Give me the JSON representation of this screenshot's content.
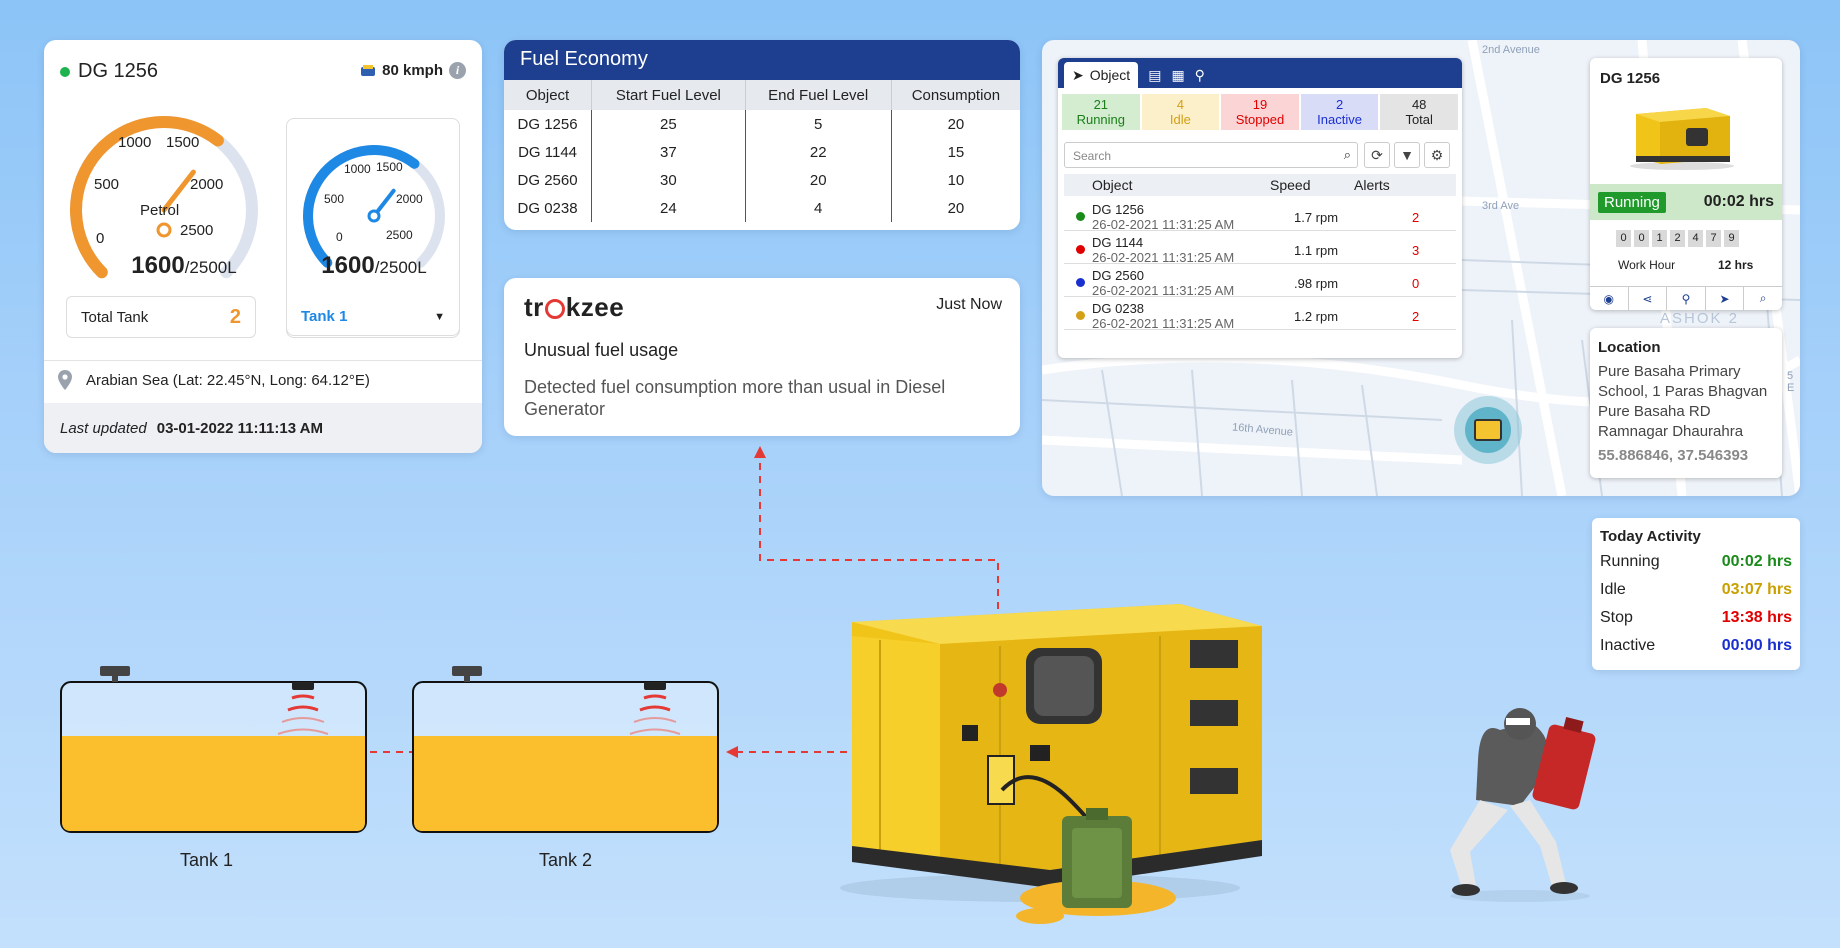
{
  "gauge_card": {
    "device": "DG 1256",
    "status_color": "#1fb34f",
    "speed": "80 kmph",
    "info_icon": "info-icon",
    "big_gauge": {
      "labels": [
        "0",
        "500",
        "1000",
        "1500",
        "2000",
        "2500"
      ],
      "center_label": "Petrol",
      "value": "1600",
      "capacity": "/2500L",
      "fill_fraction": 0.64,
      "color": "#f0962e"
    },
    "small_gauge": {
      "labels": [
        "0",
        "500",
        "1000",
        "1500",
        "2000",
        "2500"
      ],
      "value": "1600",
      "capacity": "/2500L",
      "fill_fraction": 0.64,
      "color": "#1e88e5"
    },
    "total_tank_label": "Total Tank",
    "total_tank_value": "2",
    "tank_select": "Tank 1",
    "location": "Arabian Sea (Lat: 22.45°N, Long: 64.12°E)",
    "last_updated_label": "Last updated",
    "last_updated_value": "03-01-2022 11:11:13 AM"
  },
  "fuel_economy": {
    "title": "Fuel Economy",
    "columns": [
      "Object",
      "Start Fuel Level",
      "End Fuel Level",
      "Consumption"
    ],
    "rows": [
      [
        "DG 1256",
        "25",
        "5",
        "20"
      ],
      [
        "DG 1144",
        "37",
        "22",
        "15"
      ],
      [
        "DG 2560",
        "30",
        "20",
        "10"
      ],
      [
        "DG 0238",
        "24",
        "4",
        "20"
      ]
    ]
  },
  "notification": {
    "brand_a": "tr",
    "brand_b": "kzee",
    "time": "Just Now",
    "title": "Unusual fuel usage",
    "body": "Detected fuel consumption more than usual in Diesel Generator"
  },
  "object_panel": {
    "tab_label": "Object",
    "tab_icons": [
      "clipboard-icon",
      "grid-icon",
      "person-pin-icon"
    ],
    "status": [
      {
        "count": "21",
        "label": "Running",
        "color": "#1a7f1a",
        "bg": "#d4ecd0"
      },
      {
        "count": "4",
        "label": "Idle",
        "color": "#d4a017",
        "bg": "#fbf0c9"
      },
      {
        "count": "19",
        "label": "Stopped",
        "color": "#e00000",
        "bg": "#fbd5d5"
      },
      {
        "count": "2",
        "label": "Inactive",
        "color": "#1a2fd0",
        "bg": "#d9dcf7"
      },
      {
        "count": "48",
        "label": "Total",
        "color": "#222222",
        "bg": "#e4e4e4"
      }
    ],
    "search_placeholder": "Search",
    "columns": [
      "Object",
      "Speed",
      "Alerts"
    ],
    "rows": [
      {
        "name": "DG 1256",
        "time": "26-02-2021 11:31:25 AM",
        "speed": "1.7 rpm",
        "alerts": "2",
        "color": "#1a8a1a"
      },
      {
        "name": "DG 1144",
        "time": "26-02-2021 11:31:25 AM",
        "speed": "1.1 rpm",
        "alerts": "3",
        "color": "#e00000"
      },
      {
        "name": "DG 2560",
        "time": "26-02-2021 11:31:25 AM",
        "speed": ".98 rpm",
        "alerts": "0",
        "color": "#1a2fd0"
      },
      {
        "name": "DG 0238",
        "time": "26-02-2021 11:31:25 AM",
        "speed": "1.2 rpm",
        "alerts": "2",
        "color": "#d4a017"
      }
    ]
  },
  "map": {
    "streets": [
      "3rd Ave",
      "16th Avenue",
      "ASHOK 2",
      "2nd Avenue",
      "5 E"
    ]
  },
  "dg_detail": {
    "title": "DG 1256",
    "status": "Running",
    "duration": "00:02 hrs",
    "digits": [
      "0",
      "0",
      "1",
      "2",
      "4",
      "7",
      "9"
    ],
    "work_hour_label": "Work Hour",
    "work_hour_value": "12 hrs",
    "icons": [
      "eye-icon",
      "share-icon",
      "person-pin-icon",
      "navigate-icon",
      "search-location-icon"
    ]
  },
  "location": {
    "title": "Location",
    "address": "Pure Basaha Primary School, 1 Paras Bhagvan Pure Basaha RD Ramnagar Dhaurahra",
    "coords": "55.886846, 37.546393"
  },
  "today_activity": {
    "title": "Today Activity",
    "rows": [
      {
        "label": "Running",
        "value": "00:02 hrs",
        "color": "#1a8a1a"
      },
      {
        "label": "Idle",
        "value": "03:07 hrs",
        "color": "#c9a000"
      },
      {
        "label": "Stop",
        "value": "13:38 hrs",
        "color": "#e00000"
      },
      {
        "label": "Inactive",
        "value": "00:00 hrs",
        "color": "#1a2fd0"
      }
    ]
  },
  "tanks": {
    "tank1": "Tank 1",
    "tank2": "Tank 2"
  },
  "colors": {
    "brand": "#1e3f8f",
    "fuel": "#fbbf2e",
    "flow_line": "#e53935"
  }
}
